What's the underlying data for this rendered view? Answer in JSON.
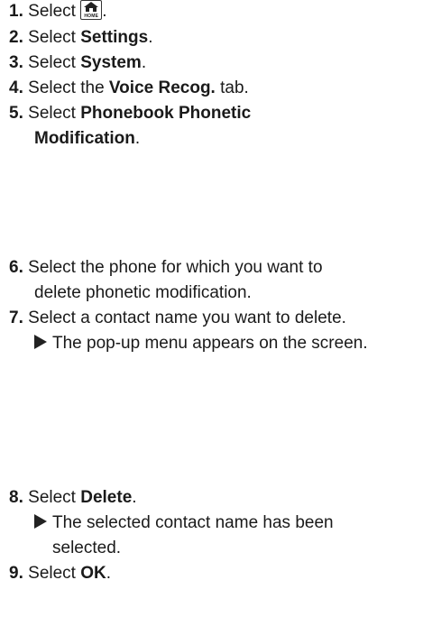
{
  "steps": [
    {
      "num": "1.",
      "pre": "Select ",
      "icon_text": "HOME",
      "icon": "home-icon",
      "post": "."
    },
    {
      "num": "2.",
      "pre": "Select ",
      "bold": "Settings",
      "post": "."
    },
    {
      "num": "3.",
      "pre": "Select ",
      "bold": "System",
      "post": "."
    },
    {
      "num": "4.",
      "pre": "Select the ",
      "bold": "Voice Recog.",
      "post": " tab."
    },
    {
      "num": "5.",
      "pre": "Select ",
      "bold": "Phonebook Phonetic",
      "bold2": "Modification",
      "post": "."
    },
    {
      "num": "6.",
      "text": "Select the phone for which you want to",
      "text2": "delete phonetic modification."
    },
    {
      "num": "7.",
      "text": "Select a contact name you want to delete."
    },
    {
      "num": "8.",
      "pre": "Select ",
      "bold": "Delete",
      "post": "."
    },
    {
      "num": "9.",
      "pre": "Select ",
      "bold": "OK",
      "post": "."
    }
  ],
  "results": [
    {
      "text": "The pop-up menu appears on the screen."
    },
    {
      "text": "The selected contact name has been",
      "text2": "selected."
    }
  ]
}
